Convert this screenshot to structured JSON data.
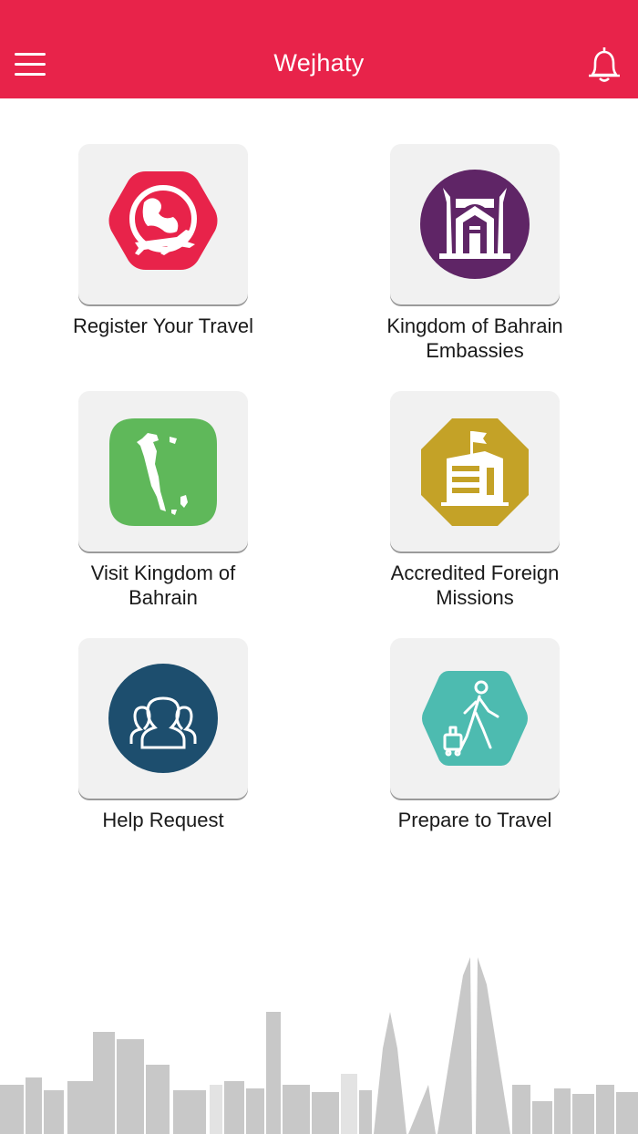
{
  "header": {
    "title": "Wejhaty",
    "background_color": "#e8234a",
    "menu_icon": "hamburger-menu-icon",
    "notification_icon": "bell-icon"
  },
  "tiles": [
    {
      "label_line1": "Register Your Travel",
      "label_line2": "",
      "icon": "globe-airplane-icon",
      "color": "#e8234a"
    },
    {
      "label_line1": "Kingdom of Bahrain",
      "label_line2": "Embassies",
      "icon": "fort-gate-icon",
      "color": "#5f2566"
    },
    {
      "label_line1": "Visit Kingdom of",
      "label_line2": "Bahrain",
      "icon": "bahrain-map-icon",
      "color": "#5fb85a"
    },
    {
      "label_line1": "Accredited Foreign",
      "label_line2": "Missions",
      "icon": "building-flag-icon",
      "color": "#c4a227"
    },
    {
      "label_line1": "Help Request",
      "label_line2": "",
      "icon": "people-group-icon",
      "color": "#1d4e6e"
    },
    {
      "label_line1": "Prepare to Travel",
      "label_line2": "",
      "icon": "traveler-luggage-icon",
      "color": "#4dbbb0"
    }
  ],
  "footer": {
    "decoration": "city-skyline",
    "color": "#c8c8c8"
  }
}
